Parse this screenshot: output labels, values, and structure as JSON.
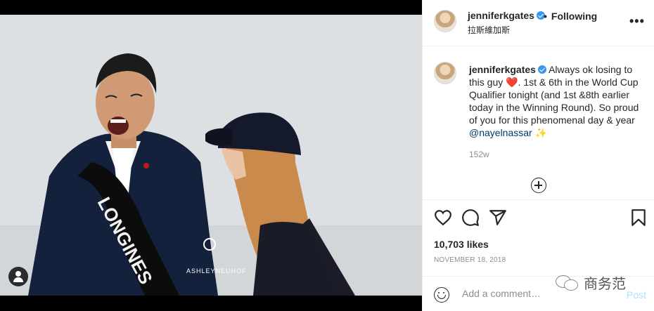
{
  "post": {
    "username": "jenniferkgates",
    "follow_status": "Following",
    "location": "拉斯維加斯",
    "more_icon": "more-horizontal-icon",
    "caption": {
      "username": "jenniferkgates",
      "text_part1": "Always ok losing to this guy",
      "heart": "❤️",
      "text_part2": ". 1st & 6th in the World Cup Qualifier tonight (and 1st &8th earlier today in the Winning Round). So proud of you for this phenomenal day & year",
      "mention": "@nayelnassar",
      "sparkle": "✨"
    },
    "caption_time": "152w",
    "likes": "10,703 likes",
    "date": "NOVEMBER 18, 2018",
    "photo": {
      "sash_text": "LONGINES",
      "watermark": "ASHLEYNEUHOF"
    }
  },
  "comment": {
    "placeholder": "Add a comment…",
    "post_label": "Post"
  },
  "watermark": {
    "text": "商务范"
  },
  "colors": {
    "verified": "#3897f0",
    "mention": "#00376b",
    "post_disabled": "#b2dffc",
    "muted": "#8e8e8e"
  },
  "icons": [
    "heart-icon",
    "comment-icon",
    "share-icon",
    "bookmark-icon",
    "emoji-icon",
    "plus-circle-icon",
    "user-tag-icon",
    "verified-badge-icon"
  ]
}
